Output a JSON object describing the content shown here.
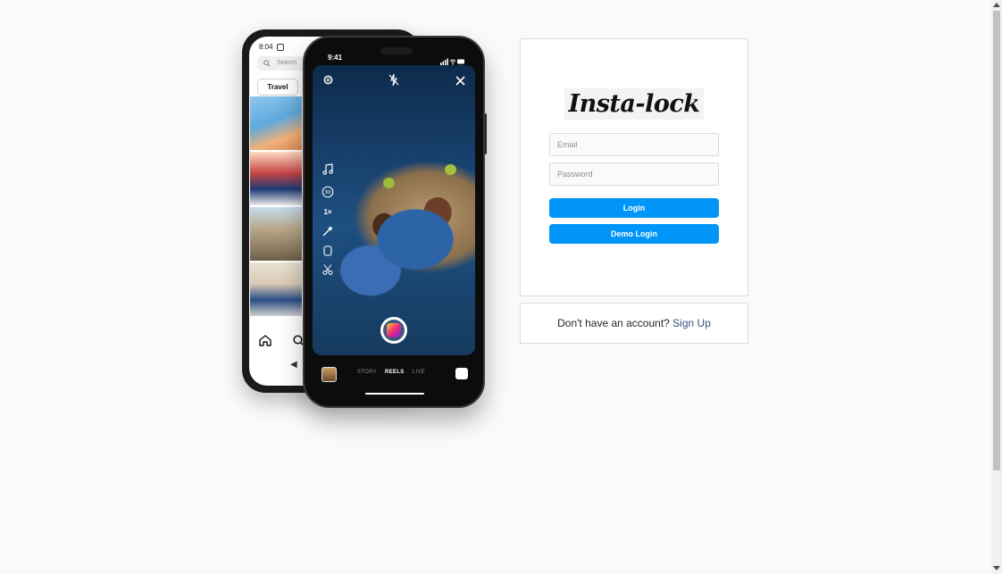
{
  "phones": {
    "back": {
      "status_time": "8:04",
      "search_placeholder": "Search",
      "chip_label": "Travel"
    },
    "front": {
      "status_time": "9:41",
      "modes": [
        "STORY",
        "REELS",
        "LIVE"
      ],
      "active_mode": "REELS",
      "tool_labels": {
        "timer": "30",
        "speed": "1×"
      }
    }
  },
  "login": {
    "logo_text": "Insta-lock",
    "email_placeholder": "Email",
    "password_placeholder": "Password",
    "login_button": "Login",
    "demo_button": "Demo Login"
  },
  "signup": {
    "prompt": "Don't have an account?",
    "link": "Sign Up"
  },
  "colors": {
    "accent": "#0095f6",
    "background": "#fafafa",
    "link": "#385185",
    "border": "#dbdbdb"
  }
}
